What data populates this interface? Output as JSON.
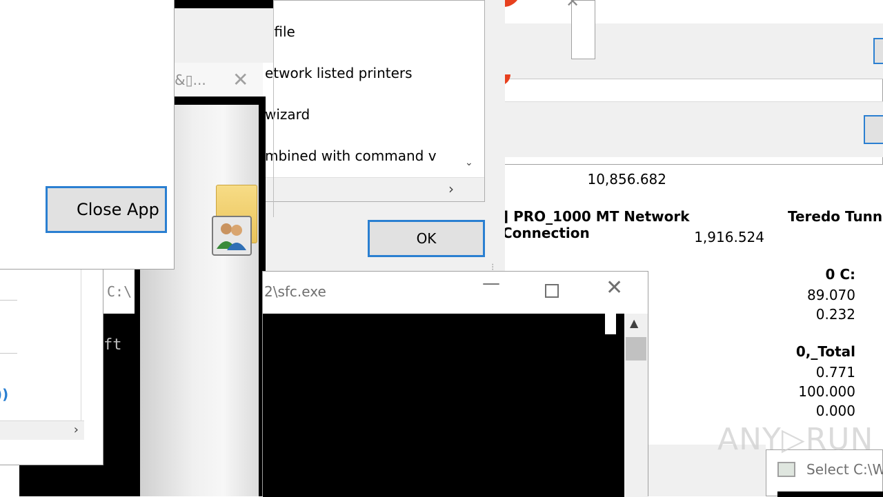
{
  "left_window": {
    "close_app_label": "Close App"
  },
  "left_console": {
    "title_fragment": "C:\\",
    "text_fragment": "ft"
  },
  "small_window": {
    "title_fragment": "&▯...",
    "close_glyph": "✕"
  },
  "printer_wizard": {
    "options": [
      "f file",
      "etwork listed printers",
      "wizard",
      "mbined with command v"
    ],
    "ok_label": "OK"
  },
  "perf_monitor": {
    "value_top": "10,856.682",
    "network_header": "] PRO_1000 MT Network Connection",
    "teredo_header": "Teredo Tunne",
    "network_value": "1,916.524",
    "disk_header": "0 C:",
    "disk_values": [
      "89.070",
      "0.232"
    ],
    "total_header": "0,_Total",
    "total_values": [
      "0.771",
      "100.000",
      "0.000"
    ]
  },
  "sfc_console": {
    "title": "2\\sfc.exe",
    "minimize_glyph": "—",
    "close_glyph": "✕"
  },
  "select_window": {
    "title": "Select C:\\W"
  },
  "watermark": "ANY▷RUN",
  "colors": {
    "accent": "#2a7fd1",
    "error": "#e7401e",
    "button_face": "#e1e1e1"
  }
}
